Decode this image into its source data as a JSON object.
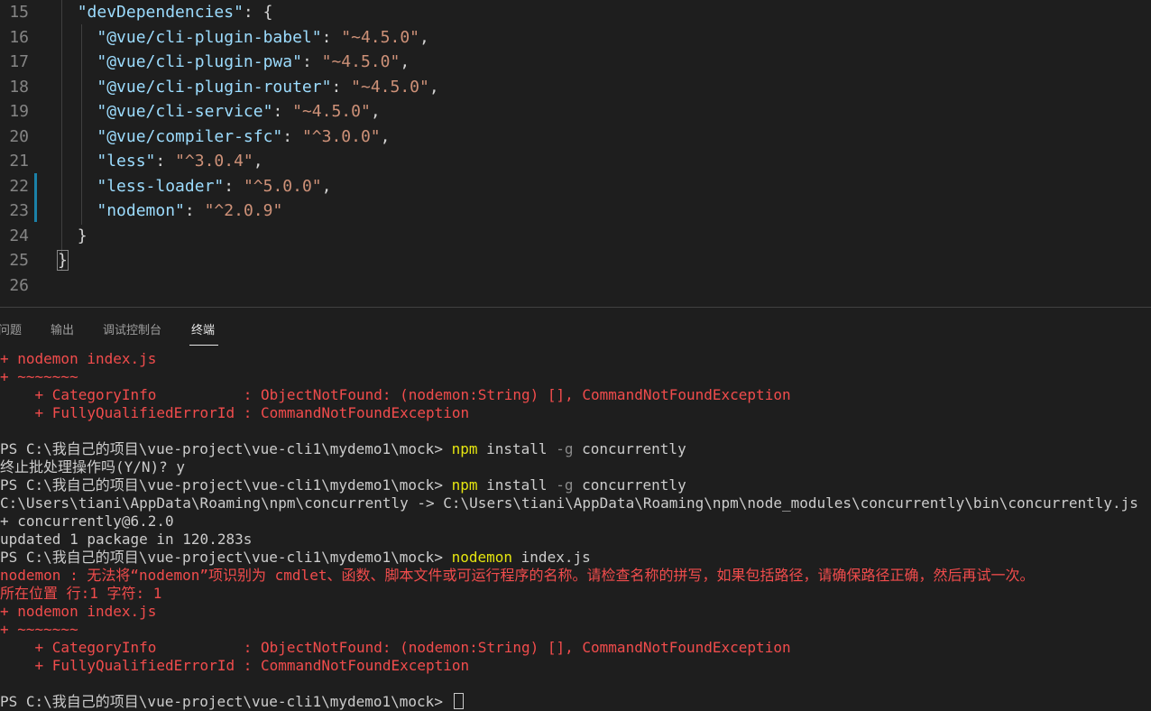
{
  "editor": {
    "lines": [
      {
        "num": "15",
        "indent": "  ",
        "key": "\"devDependencies\"",
        "sep": ": ",
        "val": "",
        "tail": "{"
      },
      {
        "num": "16",
        "indent": "    ",
        "key": "\"@vue/cli-plugin-babel\"",
        "sep": ": ",
        "val": "\"~4.5.0\"",
        "tail": ","
      },
      {
        "num": "17",
        "indent": "    ",
        "key": "\"@vue/cli-plugin-pwa\"",
        "sep": ": ",
        "val": "\"~4.5.0\"",
        "tail": ","
      },
      {
        "num": "18",
        "indent": "    ",
        "key": "\"@vue/cli-plugin-router\"",
        "sep": ": ",
        "val": "\"~4.5.0\"",
        "tail": ","
      },
      {
        "num": "19",
        "indent": "    ",
        "key": "\"@vue/cli-service\"",
        "sep": ": ",
        "val": "\"~4.5.0\"",
        "tail": ","
      },
      {
        "num": "20",
        "indent": "    ",
        "key": "\"@vue/compiler-sfc\"",
        "sep": ": ",
        "val": "\"^3.0.0\"",
        "tail": ","
      },
      {
        "num": "21",
        "indent": "    ",
        "key": "\"less\"",
        "sep": ": ",
        "val": "\"^3.0.4\"",
        "tail": ","
      },
      {
        "num": "22",
        "indent": "    ",
        "key": "\"less-loader\"",
        "sep": ": ",
        "val": "\"^5.0.0\"",
        "tail": ","
      },
      {
        "num": "23",
        "indent": "    ",
        "key": "\"nodemon\"",
        "sep": ": ",
        "val": "\"^2.0.9\"",
        "tail": ""
      },
      {
        "num": "24",
        "indent": "  ",
        "key": "",
        "sep": "",
        "val": "",
        "tail": "}"
      },
      {
        "num": "25",
        "indent": "",
        "key": "",
        "sep": "",
        "val": "",
        "tail": "}"
      },
      {
        "num": "26",
        "indent": "",
        "key": "",
        "sep": "",
        "val": "",
        "tail": ""
      }
    ]
  },
  "panel": {
    "tabs": [
      "问题",
      "输出",
      "调试控制台",
      "终端"
    ],
    "active_tab": "终端"
  },
  "terminal": {
    "l1": "+ nodemon index.js",
    "l2": "+ ~~~~~~~",
    "l3": "    + CategoryInfo          : ObjectNotFound: (nodemon:String) [], CommandNotFoundException",
    "l4": "    + FullyQualifiedErrorId : CommandNotFoundException",
    "l5_prompt": "PS C:\\我自己的项目\\vue-project\\vue-cli1\\mydemo1\\mock> ",
    "l5_cmd": "npm",
    "l5_a": " install ",
    "l5_flag": "-g",
    "l5_b": " concurrently",
    "l6": "终止批处理操作吗(Y/N)? y",
    "l7_prompt": "PS C:\\我自己的项目\\vue-project\\vue-cli1\\mydemo1\\mock> ",
    "l7_cmd": "npm",
    "l7_a": " install ",
    "l7_flag": "-g",
    "l7_b": " concurrently",
    "l8": "C:\\Users\\tiani\\AppData\\Roaming\\npm\\concurrently -> C:\\Users\\tiani\\AppData\\Roaming\\npm\\node_modules\\concurrently\\bin\\concurrently.js",
    "l9": "+ concurrently@6.2.0",
    "l10": "updated 1 package in 120.283s",
    "l11_prompt": "PS C:\\我自己的项目\\vue-project\\vue-cli1\\mydemo1\\mock> ",
    "l11_cmd": "nodemon",
    "l11_a": " index.js",
    "l12": "nodemon : 无法将“nodemon”项识别为 cmdlet、函数、脚本文件或可运行程序的名称。请检查名称的拼写，如果包括路径，请确保路径正确，然后再试一次。",
    "l13": "所在位置 行:1 字符: 1",
    "l14": "+ nodemon index.js",
    "l15": "+ ~~~~~~~",
    "l16": "    + CategoryInfo          : ObjectNotFound: (nodemon:String) [], CommandNotFoundException",
    "l17": "    + FullyQualifiedErrorId : CommandNotFoundException",
    "l18_prompt": "PS C:\\我自己的项目\\vue-project\\vue-cli1\\mydemo1\\mock> "
  }
}
